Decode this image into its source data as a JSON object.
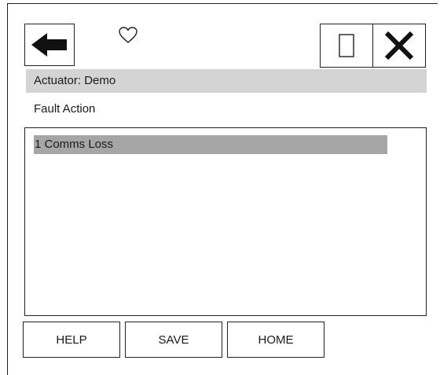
{
  "header": {
    "back_icon": "arrow-left-icon",
    "favorite_icon": "heart-outline-icon",
    "window_icon": "window-restore-icon",
    "close_icon": "close-x-icon"
  },
  "device_bar": {
    "label": "Actuator: Demo"
  },
  "page": {
    "title": "Fault Action"
  },
  "list": {
    "items": [
      {
        "label": "1 Comms Loss",
        "selected": true
      }
    ],
    "selected_color": "#a6a6a6"
  },
  "footer": {
    "help_label": "HELP",
    "save_label": "SAVE",
    "home_label": "HOME"
  },
  "colors": {
    "device_bar_bg": "#d4d4d4",
    "border": "#222222"
  }
}
